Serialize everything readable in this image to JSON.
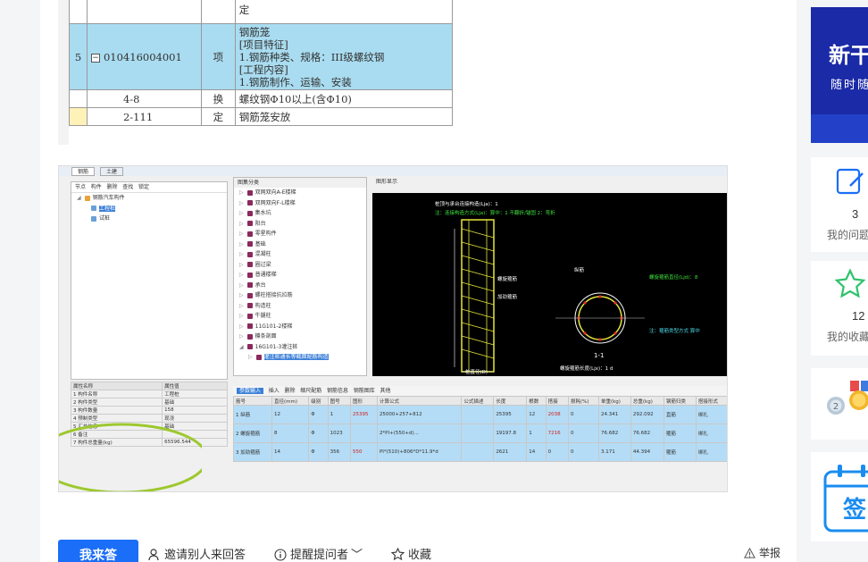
{
  "top_table": {
    "rows": [
      {
        "num": "5",
        "code": "010416004001",
        "unit": "项",
        "desc": [
          "钢筋笼",
          "[项目特征]",
          "1.钢筋种类、规格：III级螺纹钢",
          "[工程内容]",
          "1.钢筋制作、运输、安装"
        ]
      },
      {
        "num": "",
        "code": "4-8",
        "unit": "换",
        "desc": [
          "螺纹钢Φ10以上(含Φ10)"
        ]
      },
      {
        "num": "",
        "code": "2-111",
        "unit": "定",
        "desc": [
          "钢筋笼安放"
        ]
      }
    ],
    "top_fragment": "定"
  },
  "software": {
    "tabs": [
      "钢筋",
      "土建"
    ],
    "toolbar": [
      "节点",
      "构件",
      "删除",
      "查找",
      "锁定"
    ],
    "tree_root": "钢筋汽车构件",
    "tree_items": [
      "工程桩",
      "试桩"
    ],
    "list_header": "图集分类",
    "list_items": [
      "双网双向A-E楼梯",
      "双网双向F-L楼梯",
      "集水坑",
      "阳台",
      "零星构件",
      "基础",
      "混凝柱",
      "圈过梁",
      "普通楼梯",
      "承台",
      "螺柱搭接抗拉筋",
      "构造柱",
      "牛腿柱",
      "11G101-2楼梯",
      "檩条剖面",
      "16G101-3灌注桩",
      "灌注桩通长等截面配筋构造"
    ],
    "cad_header": "图形显示",
    "cad_labels": {
      "title1": "桩顶与承台连接构造(Lja)：1",
      "title2": "注：连接构造方式(Lja)：算中：1 不翻折/锚固  2：弯折",
      "label_stirrup": "螺旋箍筋",
      "label_hoop": "加劲箍筋",
      "label_long": "纵筋",
      "label_section": "1-1",
      "label_length": "桩长(L1)",
      "label_d": "桩直径(D)",
      "label_screw": "螺旋箍筋长度(Ljx)：1 d"
    },
    "grid_toolbar": [
      "参数输入",
      "插入",
      "删除",
      "缩尺配筋",
      "钢筋信息",
      "钢筋图库",
      "其他"
    ],
    "grid_headers": [
      "筋号",
      "直径(mm)",
      "级别",
      "图号",
      "图形",
      "计算公式",
      "公式描述",
      "长度",
      "根数",
      "搭接",
      "损耗(%)",
      "单重(kg)",
      "总重(kg)",
      "钢筋归类",
      "搭接形式"
    ],
    "grid_rows": [
      [
        "1 纵筋",
        "12",
        "Φ",
        "1",
        "25395",
        "25000+257+812",
        "",
        "25395",
        "12",
        "2038",
        "0",
        "24.341",
        "292.092",
        "直筋",
        "绑扎"
      ],
      [
        "2 螺旋箍筋",
        "8",
        "Φ",
        "1023",
        "",
        "2*PI+(550+d)...",
        "",
        "19197.8",
        "1",
        "7216",
        "0",
        "76.682",
        "76.682",
        "箍筋",
        "绑扎"
      ],
      [
        "3 加劲箍筋",
        "14",
        "Φ",
        "356",
        "550",
        "PI*(510)+806*D*11.9*d",
        "",
        "2621",
        "14",
        "0",
        "0",
        "3.171",
        "44.394",
        "箍筋",
        "绑扎"
      ]
    ],
    "prop_headers": [
      "属性名称",
      "属性值"
    ],
    "props": [
      [
        "1 构件名称",
        "工程桩"
      ],
      [
        "2 构件类型",
        "基础"
      ],
      [
        "3 构件数量",
        "158"
      ],
      [
        "4 预制类型",
        "现浇"
      ],
      [
        "5 汇总信息",
        "基础"
      ],
      [
        "6 备注",
        ""
      ],
      [
        "7 构件总重量(kg)",
        "65596.544"
      ]
    ]
  },
  "bottom_bar": {
    "answer_label": "我来答",
    "invite_label": "邀请别人来回答",
    "remind_label": "提醒提问者",
    "collect_label": "收藏",
    "report_label": "举报"
  },
  "sidebar": {
    "banner_line1": "新干",
    "banner_line2": "随时随",
    "my_questions_count": "3",
    "my_questions_label": "我的问题",
    "my_collections_count": "12",
    "my_collections_label": "我的收藏",
    "signin_label": "签"
  },
  "colors": {
    "accent": "#1a6ef7",
    "highlight_row": "#a9dcf0",
    "banner": "#1b2aa6"
  }
}
